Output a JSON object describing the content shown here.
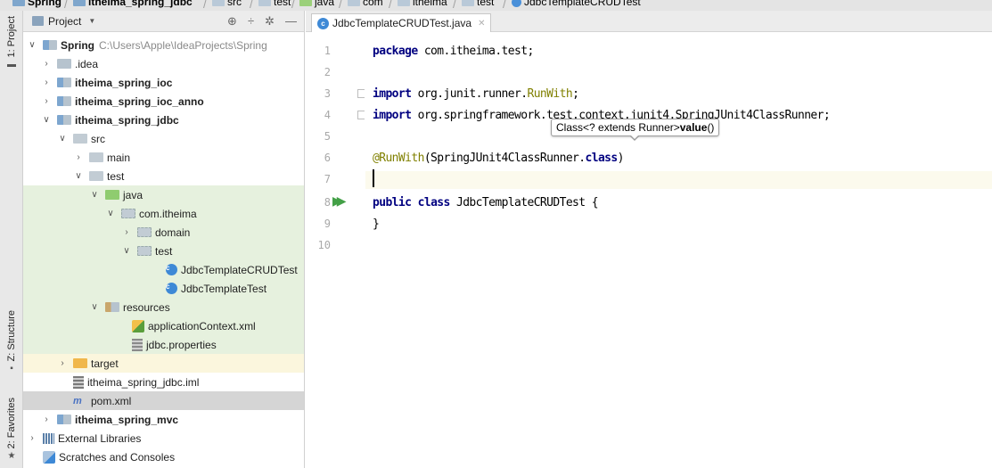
{
  "breadcrumb": [
    "Spring",
    "itheima_spring_jdbc",
    "src",
    "test",
    "java",
    "com",
    "itheima",
    "test",
    "JdbcTemplateCRUDTest"
  ],
  "tool_stripe": {
    "project": "1: Project",
    "structure": "Z: Structure",
    "favorites": "2: Favorites"
  },
  "project_panel": {
    "title": "Project",
    "tree": [
      {
        "label": "Spring",
        "path": "C:\\Users\\Apple\\IdeaProjects\\Spring",
        "bold": true
      },
      {
        "label": ".idea"
      },
      {
        "label": "itheima_spring_ioc",
        "bold": true
      },
      {
        "label": "itheima_spring_ioc_anno",
        "bold": true
      },
      {
        "label": "itheima_spring_jdbc",
        "bold": true
      },
      {
        "label": "src"
      },
      {
        "label": "main"
      },
      {
        "label": "test"
      },
      {
        "label": "java"
      },
      {
        "label": "com.itheima"
      },
      {
        "label": "domain"
      },
      {
        "label": "test"
      },
      {
        "label": "JdbcTemplateCRUDTest"
      },
      {
        "label": "JdbcTemplateTest"
      },
      {
        "label": "resources"
      },
      {
        "label": "applicationContext.xml"
      },
      {
        "label": "jdbc.properties"
      },
      {
        "label": "target"
      },
      {
        "label": "itheima_spring_jdbc.iml"
      },
      {
        "label": "pom.xml"
      },
      {
        "label": "itheima_spring_mvc",
        "bold": true
      },
      {
        "label": "External Libraries"
      },
      {
        "label": "Scratches and Consoles"
      }
    ]
  },
  "editor": {
    "tab": "JdbcTemplateCRUDTest.java",
    "line_numbers": [
      "1",
      "2",
      "3",
      "4",
      "5",
      "6",
      "7",
      "8",
      "9",
      "10"
    ],
    "code": {
      "l1_kw": "package",
      "l1_rest": " com.itheima.test;",
      "l3_kw": "import",
      "l3_a": " org.junit.runner.",
      "l3_b": "RunWith",
      "l3_c": ";",
      "l4_kw": "import",
      "l4_rest": " org.springframework.test.context.junit4.SpringJUnit4ClassRunner;",
      "l6_ann": "@RunWith",
      "l6_a": "(SpringJUnit4ClassRunner.",
      "l6_kw": "class",
      "l6_b": ")",
      "l8_kw1": "public",
      "l8_kw2": "class",
      "l8_rest": " JdbcTemplateCRUDTest {",
      "l9": "}"
    },
    "tooltip": {
      "prefix": "Class<? extends Runner> ",
      "method": "value",
      "suffix": "()"
    }
  }
}
